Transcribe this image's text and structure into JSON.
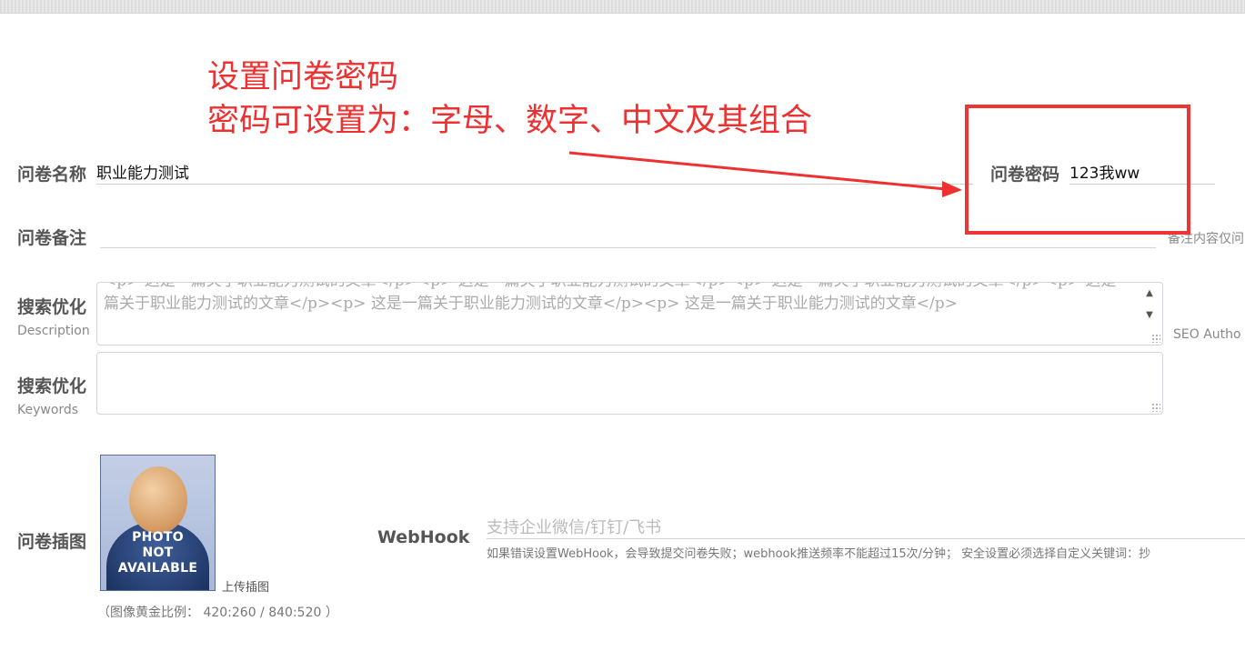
{
  "annotation": {
    "line1": "设置问卷密码",
    "line2": "密码可设置为：字母、数字、中文及其组合",
    "color": "#ee3030"
  },
  "form": {
    "name_label": "问卷名称",
    "name_value": "职业能力测试",
    "password_label": "问卷密码",
    "password_value": "123我ww",
    "remark_label": "问卷备注",
    "remark_value": "",
    "remark_note": "备注内容仅问",
    "seo_desc_label": "搜索优化",
    "seo_desc_sub": "Description",
    "seo_desc_value": "<p>        这是一篇关于职业能力测试的文章</p><p>        这是一篇关于职业能力测试的文章</p><p>        这是一篇关于职业能力测试的文章</p><p>        这是一篇关于职业能力测试的文章</p><p>        这是一篇关于职业能力测试的文章</p><p>        这是一篇关于职业能力测试的文章</p>",
    "seo_author_note": "SEO Autho",
    "seo_kw_label": "搜索优化",
    "seo_kw_sub": "Keywords",
    "seo_kw_value": "",
    "image_label": "问卷插图",
    "photo_text_line1": "PHOTO",
    "photo_text_line2": "NOT",
    "photo_text_line3": "AVAILABLE",
    "upload_label": "上传插图",
    "ratio_text": "（图像黄金比例： 420:260 / 840:520 ）",
    "webhook_label": "WebHook",
    "webhook_placeholder": "支持企业微信/钉钉/飞书",
    "webhook_help": "如果错误设置WebHook，会导致提交问卷失败；webhook推送频率不能超过15次/分钟；   安全设置必须选择自定义关键词：抄"
  },
  "scroll_icons": {
    "up": "chevron-up-icon",
    "down": "chevron-down-icon"
  }
}
